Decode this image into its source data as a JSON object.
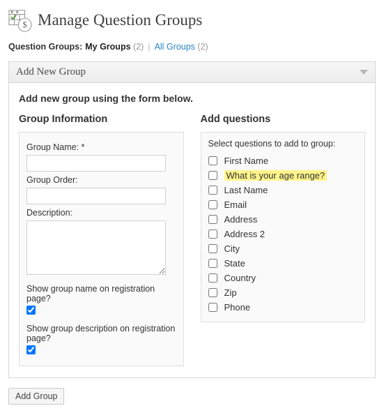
{
  "header": {
    "title": "Manage Question Groups"
  },
  "tabs": {
    "label": "Question Groups:",
    "my_groups": "My Groups",
    "my_groups_count": "(2)",
    "separator": "|",
    "all_groups": "All Groups",
    "all_groups_count": "(2)"
  },
  "panel": {
    "title": "Add New Group",
    "intro": "Add new group using the form below."
  },
  "group_info": {
    "heading": "Group Information",
    "name_label": "Group Name: *",
    "name_value": "",
    "order_label": "Group Order:",
    "order_value": "",
    "desc_label": "Description:",
    "desc_value": "",
    "show_name_label": "Show group name on registration page?",
    "show_desc_label": "Show group description on registration page?"
  },
  "questions": {
    "heading": "Add questions",
    "select_label": "Select questions to add to group:",
    "items": [
      {
        "label": "First Name",
        "highlight": false
      },
      {
        "label": "What is your age range?",
        "highlight": true
      },
      {
        "label": "Last Name",
        "highlight": false
      },
      {
        "label": "Email",
        "highlight": false
      },
      {
        "label": "Address",
        "highlight": false
      },
      {
        "label": "Address 2",
        "highlight": false
      },
      {
        "label": "City",
        "highlight": false
      },
      {
        "label": "State",
        "highlight": false
      },
      {
        "label": "Country",
        "highlight": false
      },
      {
        "label": "Zip",
        "highlight": false
      },
      {
        "label": "Phone",
        "highlight": false
      }
    ]
  },
  "actions": {
    "add_group": "Add Group"
  }
}
